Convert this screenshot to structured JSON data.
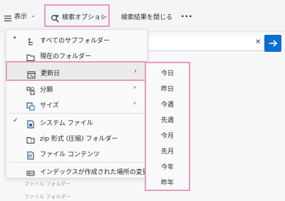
{
  "toolbar": {
    "view_label": "表示",
    "search_options_label": "検索オプション",
    "close_search_label": "検索結果を閉じる",
    "more_label": "..."
  },
  "menu": {
    "items": [
      {
        "label": "すべてのサブフォルダー",
        "checked": true,
        "icon": "subfolders-icon"
      },
      {
        "label": "現在のフォルダー",
        "checked": false,
        "icon": "folder-icon"
      },
      {
        "label": "更新日",
        "checked": false,
        "icon": "calendar-icon",
        "submenu": true
      },
      {
        "label": "分類",
        "checked": false,
        "icon": "kind-icon",
        "submenu": true
      },
      {
        "label": "サイズ",
        "checked": false,
        "icon": "size-icon",
        "submenu": true
      },
      {
        "label": "システム ファイル",
        "checked": true,
        "icon": "system-file-icon"
      },
      {
        "label": "zip 形式 (圧縮) フォルダー",
        "checked": false,
        "icon": "zip-folder-icon"
      },
      {
        "label": "ファイル コンテンツ",
        "checked": false,
        "icon": "file-contents-icon"
      },
      {
        "label": "インデックスが作成された場所の変更",
        "checked": false,
        "icon": "index-icon"
      }
    ]
  },
  "submenu": {
    "items": [
      "今日",
      "昨日",
      "今週",
      "先週",
      "今月",
      "先月",
      "今年",
      "昨年"
    ]
  },
  "background": {
    "ghost1": "ファイル フォルダー",
    "ghost2": "ファイル フォルダー"
  },
  "colors": {
    "highlight": "#e89abf",
    "accent": "#0b6fd1"
  }
}
